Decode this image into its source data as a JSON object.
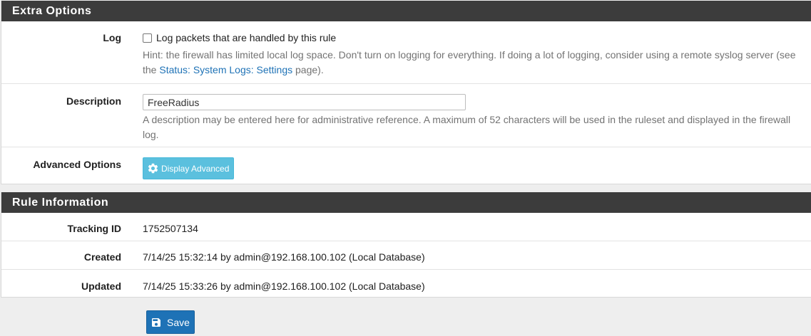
{
  "extra_options": {
    "heading": "Extra Options",
    "log": {
      "label": "Log",
      "checkbox_label": "Log packets that are handled by this rule",
      "checked": false,
      "hint_prefix": "Hint: the firewall has limited local log space. Don't turn on logging for everything. If doing a lot of logging, consider using a remote syslog server (see the ",
      "hint_link": "Status: System Logs: Settings",
      "hint_suffix": " page)."
    },
    "description": {
      "label": "Description",
      "value": "FreeRadius",
      "hint": "A description may be entered here for administrative reference. A maximum of 52 characters will be used in the ruleset and displayed in the firewall log."
    },
    "advanced": {
      "label": "Advanced Options",
      "button_label": "Display Advanced",
      "icon": "gear-icon"
    }
  },
  "rule_information": {
    "heading": "Rule Information",
    "tracking_id": {
      "label": "Tracking ID",
      "value": "1752507134"
    },
    "created": {
      "label": "Created",
      "value": "7/14/25 15:32:14 by admin@192.168.100.102 (Local Database)"
    },
    "updated": {
      "label": "Updated",
      "value": "7/14/25 15:33:26 by admin@192.168.100.102 (Local Database)"
    }
  },
  "save_button": {
    "label": "Save",
    "icon": "save-icon"
  },
  "colors": {
    "panel_heading_bg": "#3c3c3c",
    "info_button": "#5bc0de",
    "primary_button": "#1e72b6",
    "link": "#1e72b6",
    "hint_text": "#737373"
  }
}
